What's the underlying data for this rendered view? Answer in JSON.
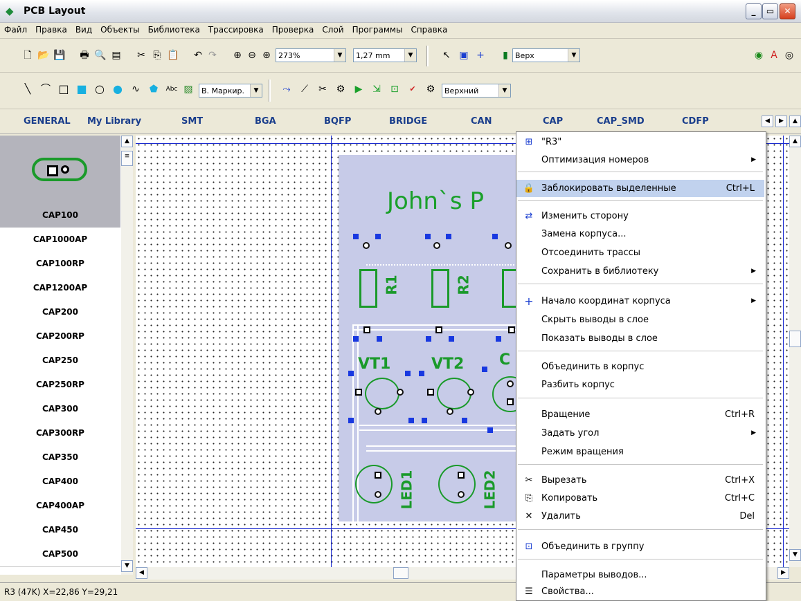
{
  "window": {
    "title": "PCB Layout"
  },
  "menubar": [
    "Файл",
    "Правка",
    "Вид",
    "Объекты",
    "Библиотека",
    "Трассировка",
    "Проверка",
    "Слой",
    "Программы",
    "Справка"
  ],
  "toolbar1": {
    "zoom": "273%",
    "grid": "1,27 mm",
    "side": "Верх"
  },
  "toolbar2": {
    "text_style": "В. Маркир.",
    "layer": "Верхний",
    "abc_label": "Abc"
  },
  "library_tabs": [
    "GENERAL",
    "My Library",
    "SMT",
    "BGA",
    "BQFP",
    "BRIDGE",
    "CAN",
    "CAP",
    "CAP_SMD",
    "CDFP"
  ],
  "library": {
    "selected": "CAP100",
    "items": [
      "CAP100",
      "CAP1000AP",
      "CAP100RP",
      "CAP1200AP",
      "CAP200",
      "CAP200RP",
      "CAP250",
      "CAP250RP",
      "CAP300",
      "CAP300RP",
      "CAP350",
      "CAP400",
      "CAP400AP",
      "CAP450",
      "CAP500"
    ]
  },
  "board": {
    "title": "John`s P",
    "labels": [
      "R1",
      "R2",
      "VT1",
      "VT2",
      "C",
      "LED1",
      "LED2"
    ]
  },
  "context_menu": {
    "items": [
      {
        "label": "\"R3\"",
        "icon": "component-icon"
      },
      {
        "label": "Оптимизация номеров",
        "submenu": true
      },
      {
        "label": "Заблокировать выделенные",
        "shortcut": "Ctrl+L",
        "icon": "lock-icon",
        "highlighted": true
      },
      {
        "label": "Изменить сторону",
        "icon": "flip-side-icon"
      },
      {
        "label": "Замена корпуса..."
      },
      {
        "label": "Отсоединить трассы"
      },
      {
        "label": "Сохранить в библиотеку",
        "submenu": true
      },
      {
        "label": "Начало координат корпуса",
        "submenu": true,
        "icon": "crosshair-icon"
      },
      {
        "label": "Скрыть выводы в слое"
      },
      {
        "label": "Показать выводы в слое"
      },
      {
        "label": "Объединить в корпус"
      },
      {
        "label": "Разбить корпус"
      },
      {
        "label": "Вращение",
        "shortcut": "Ctrl+R"
      },
      {
        "label": "Задать угол",
        "submenu": true
      },
      {
        "label": "Режим вращения"
      },
      {
        "label": "Вырезать",
        "shortcut": "Ctrl+X",
        "icon": "cut-icon"
      },
      {
        "label": "Копировать",
        "shortcut": "Ctrl+C",
        "icon": "copy-icon"
      },
      {
        "label": "Удалить",
        "shortcut": "Del",
        "icon": "delete-icon"
      },
      {
        "label": "Объединить в группу",
        "icon": "group-icon"
      },
      {
        "label": "Параметры выводов..."
      },
      {
        "label": "Свойства...",
        "icon": "properties-icon"
      }
    ]
  },
  "status": {
    "text": "R3 (47K)  X=22,86  Y=29,21"
  }
}
